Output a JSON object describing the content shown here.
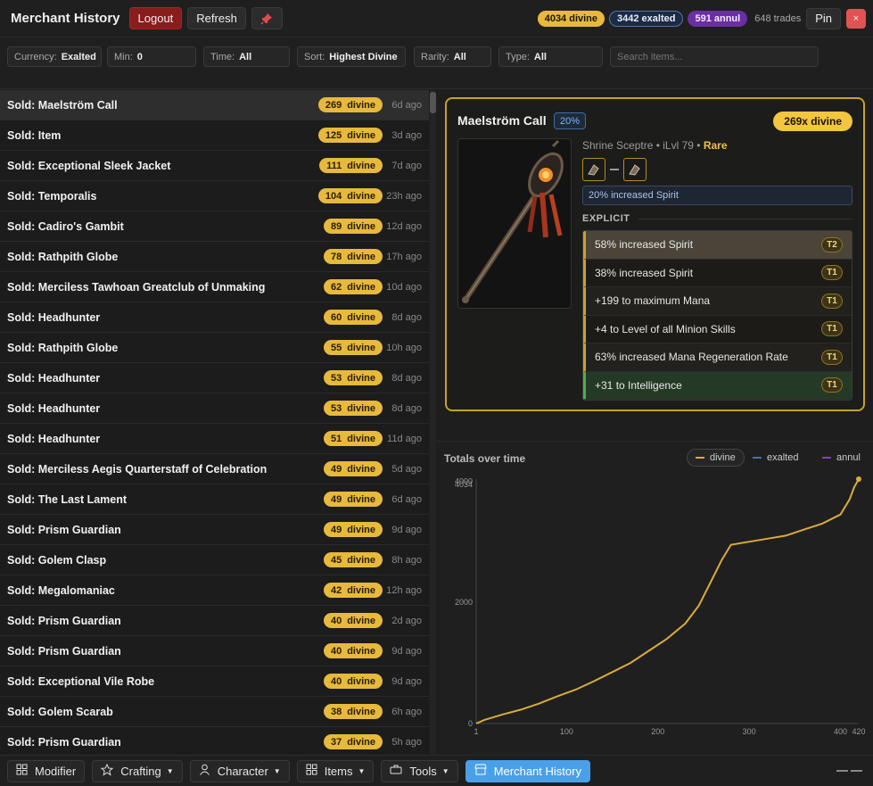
{
  "header": {
    "title": "Merchant History",
    "logout_label": "Logout",
    "refresh_label": "Refresh",
    "pin_label": "Pin",
    "close_label": "×",
    "totals": {
      "divine": "4034 divine",
      "exalted": "3442 exalted",
      "annul": "591 annul",
      "trades": "648 trades"
    }
  },
  "filters": {
    "currency": {
      "label": "Currency:",
      "value": "Exalted"
    },
    "min": {
      "label": "Min:",
      "value": "0"
    },
    "time": {
      "label": "Time:",
      "value": "All"
    },
    "sort": {
      "label": "Sort:",
      "value": "Highest Divine"
    },
    "rarity": {
      "label": "Rarity:",
      "value": "All"
    },
    "type": {
      "label": "Type:",
      "value": "All"
    },
    "search_placeholder": "Search items..."
  },
  "trades": [
    {
      "label": "Sold: Maelström Call",
      "amount": "269",
      "currency": "divine",
      "time": "6d ago"
    },
    {
      "label": "Sold: Item",
      "amount": "125",
      "currency": "divine",
      "time": "3d ago"
    },
    {
      "label": "Sold: Exceptional Sleek Jacket",
      "amount": "111",
      "currency": "divine",
      "time": "7d ago"
    },
    {
      "label": "Sold: Temporalis",
      "amount": "104",
      "currency": "divine",
      "time": "23h ago"
    },
    {
      "label": "Sold: Cadiro's Gambit",
      "amount": "89",
      "currency": "divine",
      "time": "12d ago"
    },
    {
      "label": "Sold: Rathpith Globe",
      "amount": "78",
      "currency": "divine",
      "time": "17h ago"
    },
    {
      "label": "Sold: Merciless Tawhoan Greatclub of Unmaking",
      "amount": "62",
      "currency": "divine",
      "time": "10d ago"
    },
    {
      "label": "Sold: Headhunter",
      "amount": "60",
      "currency": "divine",
      "time": "8d ago"
    },
    {
      "label": "Sold: Rathpith Globe",
      "amount": "55",
      "currency": "divine",
      "time": "10h ago"
    },
    {
      "label": "Sold: Headhunter",
      "amount": "53",
      "currency": "divine",
      "time": "8d ago"
    },
    {
      "label": "Sold: Headhunter",
      "amount": "53",
      "currency": "divine",
      "time": "8d ago"
    },
    {
      "label": "Sold: Headhunter",
      "amount": "51",
      "currency": "divine",
      "time": "11d ago"
    },
    {
      "label": "Sold: Merciless Aegis Quarterstaff of Celebration",
      "amount": "49",
      "currency": "divine",
      "time": "5d ago"
    },
    {
      "label": "Sold: The Last Lament",
      "amount": "49",
      "currency": "divine",
      "time": "6d ago"
    },
    {
      "label": "Sold: Prism Guardian",
      "amount": "49",
      "currency": "divine",
      "time": "9d ago"
    },
    {
      "label": "Sold: Golem Clasp",
      "amount": "45",
      "currency": "divine",
      "time": "8h ago"
    },
    {
      "label": "Sold: Megalomaniac",
      "amount": "42",
      "currency": "divine",
      "time": "12h ago"
    },
    {
      "label": "Sold: Prism Guardian",
      "amount": "40",
      "currency": "divine",
      "time": "2d ago"
    },
    {
      "label": "Sold: Prism Guardian",
      "amount": "40",
      "currency": "divine",
      "time": "9d ago"
    },
    {
      "label": "Sold: Exceptional Vile Robe",
      "amount": "40",
      "currency": "divine",
      "time": "9d ago"
    },
    {
      "label": "Sold: Golem Scarab",
      "amount": "38",
      "currency": "divine",
      "time": "6h ago"
    },
    {
      "label": "Sold: Prism Guardian",
      "amount": "37",
      "currency": "divine",
      "time": "5h ago"
    }
  ],
  "detail": {
    "name": "Maelström Call",
    "quality": "20%",
    "price": "269x divine",
    "base": "Shrine Sceptre • iLvl 79 •",
    "rarity": "Rare",
    "rune_icon": "rune-socket-icon",
    "implicit": "20% increased Spirit",
    "explicit_label": "EXPLICIT",
    "mods": [
      {
        "text": "58% increased Spirit",
        "tier": "T2"
      },
      {
        "text": "38% increased Spirit",
        "tier": "T1"
      },
      {
        "text": "+199 to maximum Mana",
        "tier": "T1"
      },
      {
        "text": "+4 to Level of all Minion Skills",
        "tier": "T1"
      },
      {
        "text": "63% increased Mana Regeneration Rate",
        "tier": "T1"
      },
      {
        "text": "+31 to Intelligence",
        "tier": "T1"
      }
    ]
  },
  "chart_data": {
    "type": "line",
    "title": "Totals over time",
    "legend": [
      "divine",
      "exalted",
      "annul"
    ],
    "active_series": "divine",
    "colors": {
      "divine": "#d8ac3a",
      "exalted": "#4a6fa5",
      "annul": "#7a4ab0"
    },
    "x_ticks": [
      1,
      100,
      200,
      300,
      400,
      420
    ],
    "y_ticks": [
      0,
      2000,
      4000
    ],
    "y_extra_label": "4034",
    "xlim": [
      1,
      420
    ],
    "ylim": [
      0,
      4034
    ],
    "series": [
      {
        "name": "divine",
        "points": [
          [
            1,
            0
          ],
          [
            10,
            60
          ],
          [
            30,
            150
          ],
          [
            50,
            230
          ],
          [
            70,
            330
          ],
          [
            90,
            450
          ],
          [
            110,
            560
          ],
          [
            130,
            700
          ],
          [
            150,
            850
          ],
          [
            170,
            1000
          ],
          [
            190,
            1200
          ],
          [
            210,
            1400
          ],
          [
            230,
            1650
          ],
          [
            245,
            1950
          ],
          [
            260,
            2400
          ],
          [
            270,
            2700
          ],
          [
            280,
            2950
          ],
          [
            300,
            3000
          ],
          [
            320,
            3050
          ],
          [
            340,
            3100
          ],
          [
            360,
            3200
          ],
          [
            380,
            3300
          ],
          [
            400,
            3450
          ],
          [
            410,
            3700
          ],
          [
            415,
            3900
          ],
          [
            420,
            4034
          ]
        ]
      },
      {
        "name": "exalted",
        "points": []
      },
      {
        "name": "annul",
        "points": []
      }
    ]
  },
  "bottom_tabs": [
    {
      "label": "Modifier",
      "icon": "grid-icon",
      "caret": false
    },
    {
      "label": "Crafting",
      "icon": "star-icon",
      "caret": true
    },
    {
      "label": "Character",
      "icon": "user-icon",
      "caret": true
    },
    {
      "label": "Items",
      "icon": "grid-icon",
      "caret": true
    },
    {
      "label": "Tools",
      "icon": "toolbox-icon",
      "caret": true
    },
    {
      "label": "Merchant History",
      "icon": "storefront-icon",
      "caret": false
    }
  ]
}
